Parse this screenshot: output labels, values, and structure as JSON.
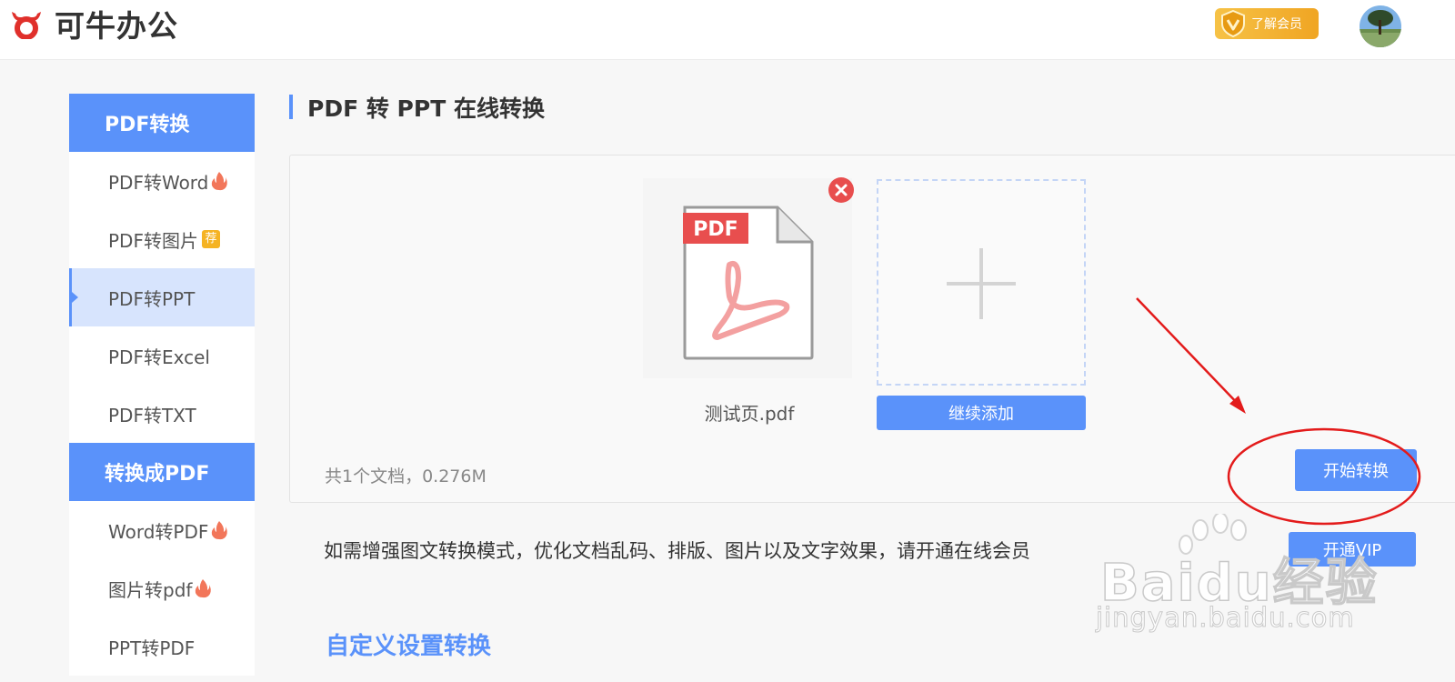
{
  "header": {
    "brand": "可牛办公",
    "vip_label": "了解会员"
  },
  "sidebar": {
    "sections": [
      {
        "title": "PDF转换",
        "items": [
          {
            "label": "PDF转Word",
            "badge": "fire"
          },
          {
            "label": "PDF转图片",
            "badge": "荐"
          },
          {
            "label": "PDF转PPT",
            "badge": "",
            "active": true
          },
          {
            "label": "PDF转Excel",
            "badge": ""
          },
          {
            "label": "PDF转TXT",
            "badge": ""
          }
        ]
      },
      {
        "title": "转换成PDF",
        "items": [
          {
            "label": "Word转PDF",
            "badge": "fire"
          },
          {
            "label": "图片转pdf",
            "badge": "fire"
          },
          {
            "label": "PPT转PDF",
            "badge": ""
          }
        ]
      }
    ]
  },
  "main": {
    "title": "PDF 转 PPT 在线转换",
    "file": {
      "type_label": "PDF",
      "name": "测试页.pdf"
    },
    "add_more_label": "继续添加",
    "summary": "共1个文档，0.276M",
    "start_label": "开始转换",
    "notice": "如需增强图文转换模式，优化文档乱码、排版、图片以及文字效果，请开通在线会员",
    "vip_open_label": "开通VIP",
    "custom_title": "自定义设置转换"
  },
  "watermark": {
    "main": "Baidu经验",
    "sub": "jingyan.baidu.com"
  },
  "colors": {
    "accent": "#5a92fa",
    "brand_red": "#e0302b",
    "gold": "#f0a523",
    "annotation_red": "#e31b1b"
  }
}
